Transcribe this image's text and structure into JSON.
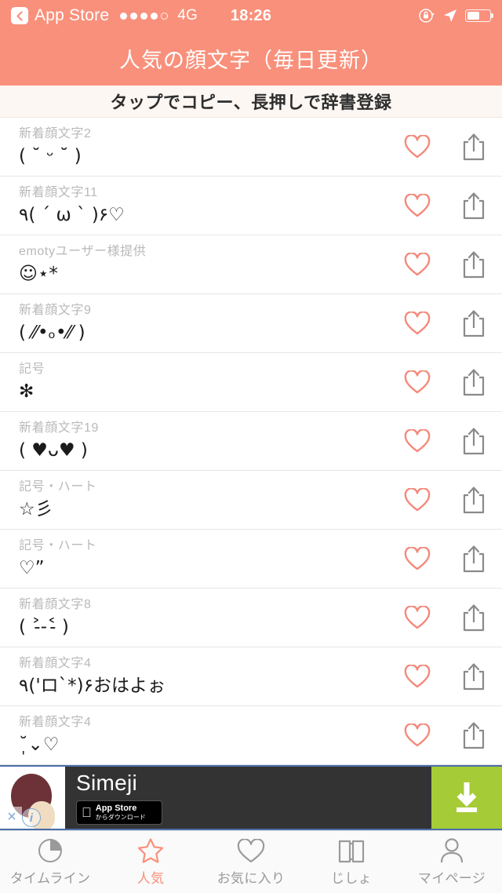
{
  "statusbar": {
    "back_app": "App Store",
    "signal_filled": 4,
    "signal_total": 5,
    "carrier": "4G",
    "time": "18:26",
    "battery_percent": 55,
    "icons": [
      "rotation-lock-icon",
      "location-arrow-icon",
      "battery-icon"
    ]
  },
  "header": {
    "title": "人気の顔文字（毎日更新）",
    "color": "#F9907B"
  },
  "subtitle": {
    "text": "タップでコピー、長押しで辞書登録",
    "bg": "#FDF7F3"
  },
  "list": {
    "heart_color": "#F4897B",
    "share_color": "#8a8a8a",
    "rows": [
      {
        "category": "新着顔文字2",
        "kaomoji": "( ˘ ᵕ ˘ )"
      },
      {
        "category": "新着顔文字11",
        "kaomoji": "٩( ´ ω ` )۶♡"
      },
      {
        "category": "emotyユーザー様提供",
        "kaomoji": "☺⋆*"
      },
      {
        "category": "新着顔文字9",
        "kaomoji": "( ⁄⁄•ₒ•⁄⁄ )"
      },
      {
        "category": "記号",
        "kaomoji": "✻"
      },
      {
        "category": "新着顔文字19",
        "kaomoji": "( ♥ᴗ♥ )"
      },
      {
        "category": "記号・ハート",
        "kaomoji": "☆彡"
      },
      {
        "category": "記号・ハート",
        "kaomoji": "♡”"
      },
      {
        "category": "新着顔文字8",
        "kaomoji": "( ˃̵-˂̵ )"
      },
      {
        "category": "新着顔文字4",
        "kaomoji": "٩('ロ`*)۶おはよぉ"
      },
      {
        "category": "新着顔文字4",
        "kaomoji": "˘̩̩̩⌄♡"
      }
    ],
    "action_labels": {
      "favorite": "お気に入り",
      "share": "共有"
    }
  },
  "ad": {
    "title": "Simeji",
    "badge_line1": "App Store",
    "badge_line2": "からダウンロード",
    "cta_icon": "download-icon",
    "close_label": "×",
    "info_label": "i",
    "cta_color": "#A5CC36",
    "bg_color": "#333333"
  },
  "tabbar": {
    "active_color": "#F9907B",
    "inactive_color": "#9a9a9a",
    "tabs": [
      {
        "label": "タイムライン",
        "icon": "clock-icon",
        "active": false
      },
      {
        "label": "人気",
        "icon": "star-icon",
        "active": true
      },
      {
        "label": "お気に入り",
        "icon": "heart-icon",
        "active": false
      },
      {
        "label": "じしょ",
        "icon": "book-icon",
        "active": false
      },
      {
        "label": "マイページ",
        "icon": "person-icon",
        "active": false
      }
    ]
  }
}
